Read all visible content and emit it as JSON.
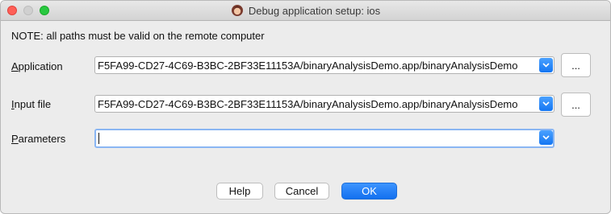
{
  "window": {
    "title": "Debug application setup: ios"
  },
  "note": "NOTE: all paths must be valid on the remote computer",
  "fields": {
    "application": {
      "label_first": "A",
      "label_rest": "pplication",
      "value": "F5FA99-CD27-4C69-B3BC-2BF33E11153A/binaryAnalysisDemo.app/binaryAnalysisDemo",
      "browse_label": "..."
    },
    "input_file": {
      "label_first": "I",
      "label_rest": "nput file",
      "value": "F5FA99-CD27-4C69-B3BC-2BF33E11153A/binaryAnalysisDemo.app/binaryAnalysisDemo",
      "browse_label": "..."
    },
    "parameters": {
      "label_first": "P",
      "label_rest": "arameters",
      "value": ""
    }
  },
  "buttons": {
    "help": "Help",
    "cancel": "Cancel",
    "ok": "OK"
  },
  "colors": {
    "accent": "#1476f2",
    "close": "#fe5f57",
    "maximize": "#28c840"
  },
  "icons": {
    "app": "debugger-app-icon",
    "dropdown": "chevron-down-icon"
  }
}
